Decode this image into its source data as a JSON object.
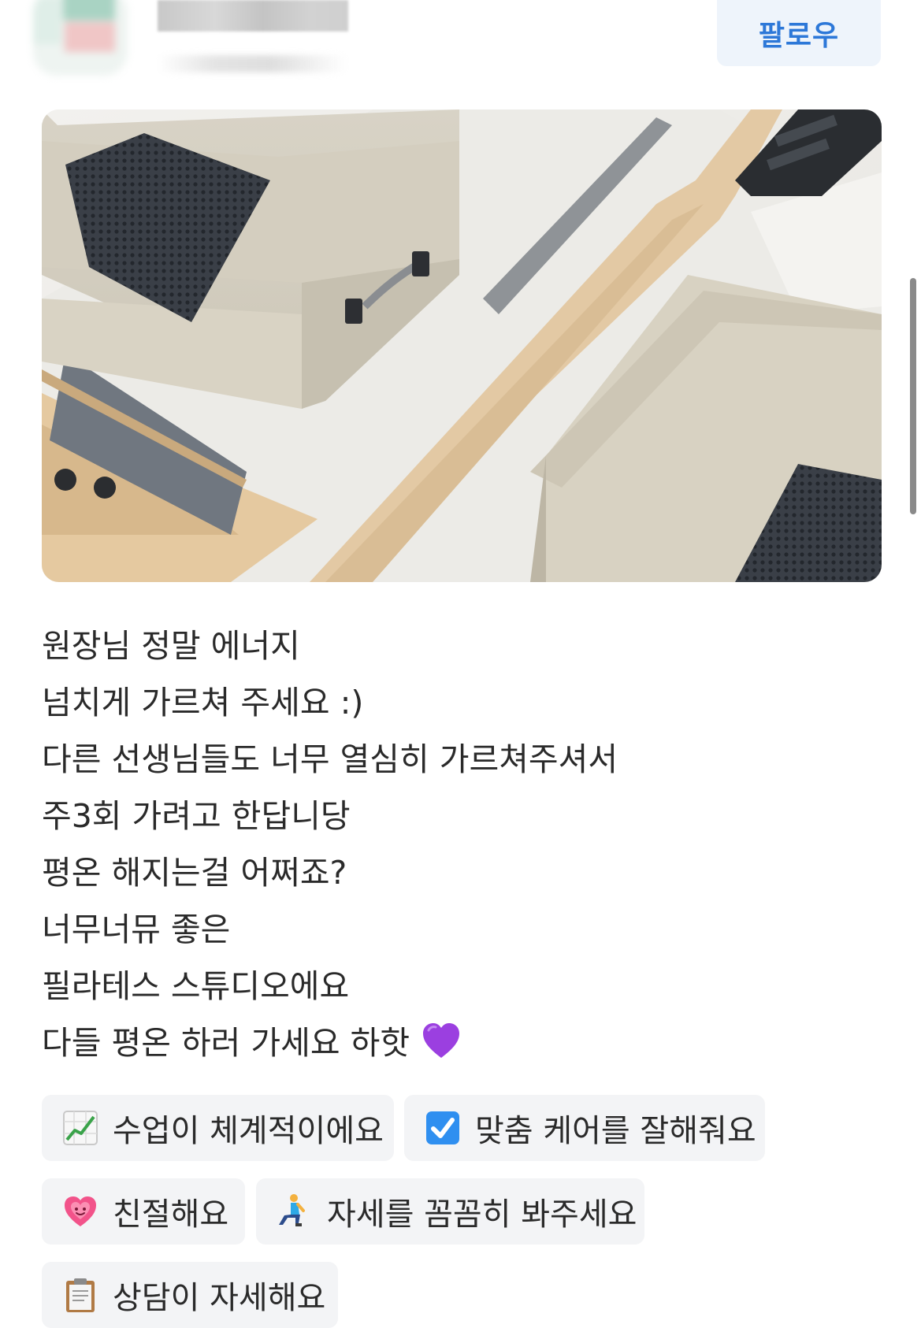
{
  "header": {
    "follow_label": "팔로우"
  },
  "review": {
    "lines": [
      "원장님 정말 에너지",
      "넘치게 가르쳐 주세요 :)",
      "다른 선생님들도 너무 열심히 가르쳐주셔서",
      "주3회 가려고 한답니당",
      "평온 해지는걸 어쩌죠?",
      "너무너뮤 좋은",
      "필라테스 스튜디오에요",
      "다들 평온 하러 가세요 하핫"
    ],
    "trailing_emoji": "purple-heart-icon"
  },
  "chips": [
    {
      "icon": "chart-increasing-icon",
      "label": "수업이 체계적이에요"
    },
    {
      "icon": "check-box-icon",
      "label": "맞춤 케어를 잘해줘요"
    },
    {
      "icon": "growing-heart-icon",
      "label": "친절해요"
    },
    {
      "icon": "kneeling-person-icon",
      "label": "자세를 꼼꼼히 봐주세요"
    },
    {
      "icon": "clipboard-icon",
      "label": "상담이 자세해요"
    }
  ],
  "colors": {
    "follow_text": "#2d78d8",
    "follow_bg": "#eef4fb",
    "chip_bg": "#f3f4f6",
    "text": "#2a2a2a"
  }
}
